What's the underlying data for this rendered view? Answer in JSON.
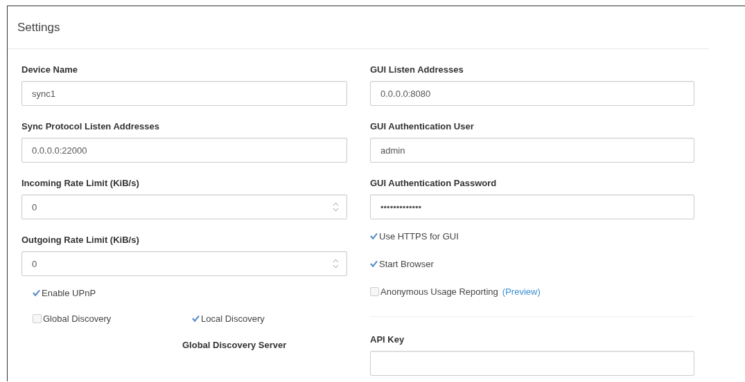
{
  "panel": {
    "title": "Settings"
  },
  "left": [
    {
      "kind": "field",
      "label": "Device Name",
      "value": "sync1"
    },
    {
      "kind": "field",
      "label": "Sync Protocol Listen Addresses",
      "value": "0.0.0.0:22000"
    },
    {
      "kind": "number",
      "label": "Incoming Rate Limit (KiB/s)",
      "value": "0"
    },
    {
      "kind": "number",
      "label": "Outgoing Rate Limit (KiB/s)",
      "value": "0"
    },
    {
      "kind": "checkbox",
      "label": "Enable UPnP",
      "checked": true
    },
    {
      "kind": "checkbox_pair",
      "items": [
        {
          "label": "Global Discovery",
          "checked": false
        },
        {
          "label": "Local Discovery",
          "checked": true
        }
      ]
    },
    {
      "kind": "heading",
      "label": "Global Discovery Server"
    }
  ],
  "right": [
    {
      "kind": "field",
      "label": "GUI Listen Addresses",
      "value": "0.0.0.0:8080"
    },
    {
      "kind": "field",
      "label": "GUI Authentication User",
      "value": "admin"
    },
    {
      "kind": "field",
      "label": "GUI Authentication Password",
      "value": "•••••••••••••"
    },
    {
      "kind": "checkbox",
      "label": "Use HTTPS for GUI",
      "checked": true
    },
    {
      "kind": "checkbox",
      "label": "Start Browser",
      "checked": true
    },
    {
      "kind": "checkbox",
      "label": "Anonymous Usage Reporting",
      "link": "(Preview)",
      "checked": false
    },
    {
      "kind": "divider"
    },
    {
      "kind": "field_cut",
      "label": "API Key"
    }
  ]
}
